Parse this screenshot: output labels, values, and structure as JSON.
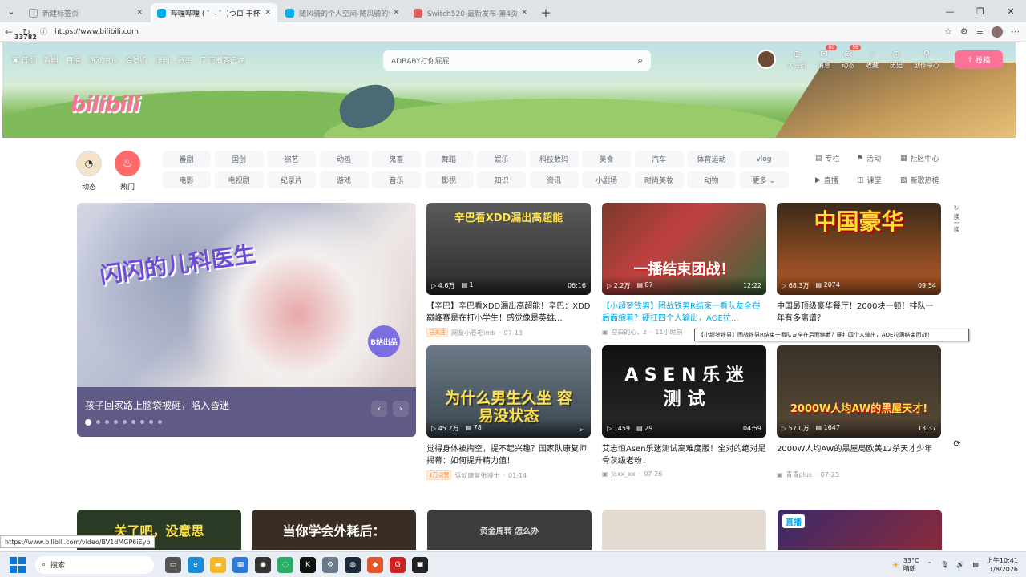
{
  "browser": {
    "tabs": [
      {
        "title": "新建标签页",
        "color": "#999",
        "active": false
      },
      {
        "title": "哔哩哔哩 ( ゜- ゜)つロ 干杯~-bilibili",
        "color": "#00aeec",
        "active": true
      },
      {
        "title": "随风骑的个人空间-随风骑的个人",
        "color": "#00aeec",
        "active": false
      },
      {
        "title": "Switch520-最新发布-第4页",
        "color": "#e05d5d",
        "active": false
      }
    ],
    "url": "https://www.bilibili.com",
    "status_url": "https://www.bilibili.com/video/BV1dMGP6iEyb",
    "page_number": "33782"
  },
  "header": {
    "nav": [
      "首页",
      "番剧",
      "直播",
      "游戏中心",
      "会员购",
      "漫画",
      "赛事",
      "下载客户端"
    ],
    "logo": "bilibili",
    "search_placeholder": "ADBABY打你屁屁",
    "user_items": [
      {
        "label": "大会员",
        "icon": "⊕",
        "badge": ""
      },
      {
        "label": "消息",
        "icon": "✉",
        "badge": "80"
      },
      {
        "label": "动态",
        "icon": "◎",
        "badge": "58"
      },
      {
        "label": "收藏",
        "icon": "☆",
        "badge": ""
      },
      {
        "label": "历史",
        "icon": "◷",
        "badge": ""
      },
      {
        "label": "创作中心",
        "icon": "⚲",
        "badge": ""
      }
    ],
    "upload_label": "投稿"
  },
  "channels": {
    "left": [
      {
        "label": "动态"
      },
      {
        "label": "热门"
      }
    ],
    "grid": [
      "番剧",
      "国创",
      "综艺",
      "动画",
      "鬼畜",
      "舞蹈",
      "娱乐",
      "科技数码",
      "美食",
      "汽车",
      "体育运动",
      "vlog",
      "电影",
      "电视剧",
      "纪录片",
      "游戏",
      "音乐",
      "影视",
      "知识",
      "资讯",
      "小剧场",
      "时尚美妆",
      "动物",
      "更多 ⌄"
    ],
    "right": [
      "专栏",
      "活动",
      "社区中心",
      "直播",
      "课堂",
      "新歌热榜"
    ]
  },
  "carousel": {
    "show_title": "闪闪的儿科医生",
    "badge": "B站出品",
    "caption": "孩子回家路上脑袋被砸，陷入昏迷",
    "dots": 9,
    "active_dot": 0
  },
  "videos": [
    {
      "views": "4.6万",
      "danmaku": "1",
      "duration": "06:16",
      "overlay": "辛巴看XDD漏出高超能",
      "title": "【辛巴】辛巴看XDD漏出高超能！辛巴：XDD巅峰赛是在打小学生！感觉像是英雄...",
      "tag": "已关注",
      "author": "网友小卷毛imb",
      "date": "07-13",
      "hover": false
    },
    {
      "views": "2.2万",
      "danmaku": "87",
      "duration": "12:22",
      "overlay": "一播结束团战！",
      "title": "【小超梦铁男】团战铁男R结束一看队友全在后面缩着？硬扛四个人输出，AOE拉...",
      "tag": "",
      "author": "空白的心、z",
      "date": "11小时前",
      "hover": true
    },
    {
      "views": "68.3万",
      "danmaku": "2074",
      "duration": "09:54",
      "overlay": "中国豪华",
      "title": "中国最顶级豪华餐厅！2000块一顿！排队一年有多离谱？",
      "tag": "",
      "author": "",
      "date": "",
      "hover": false
    },
    {
      "views": "45.2万",
      "danmaku": "78",
      "duration": "",
      "overlay": "为什么男生久坐 容易没状态",
      "title": "觉得身体被掏空，提不起兴趣？国家队康复师揭幕：如何提升精力值！",
      "tag": "1万点赞",
      "author": "运动康复张博士",
      "date": "01-14",
      "hover": false
    },
    {
      "views": "1459",
      "danmaku": "29",
      "duration": "04:59",
      "overlay": "A S E N 乐 迷 测 试",
      "title": "艾志恒Asen乐迷测试高难度版！全对的绝对是骨灰级老粉！",
      "tag": "",
      "author": "Jaxx_xx",
      "date": "07-26",
      "hover": false
    },
    {
      "views": "57.0万",
      "danmaku": "1647",
      "duration": "13:37",
      "overlay": "2000W人均AW的黑屋天才!",
      "title": "2000W人均AW的黑屋局欧美12杀天才少年",
      "tag": "",
      "author": "青青plus",
      "date": "07-25",
      "hover": false
    }
  ],
  "tooltip": "【小超梦铁男】团战铁男R结束一看队友全在后面缩着？硬扛四个人输出，AOE拉满结束团战！",
  "side_refresh": "换一换",
  "row3": [
    "关了吧，没意思",
    "当你学会外耗后：",
    "资金周转 怎么办",
    "",
    "直播"
  ],
  "taskbar": {
    "search": "搜索",
    "weather_temp": "33°C",
    "weather_desc": "晴朗",
    "time": "上午10:41",
    "date": "1/8/2026"
  }
}
